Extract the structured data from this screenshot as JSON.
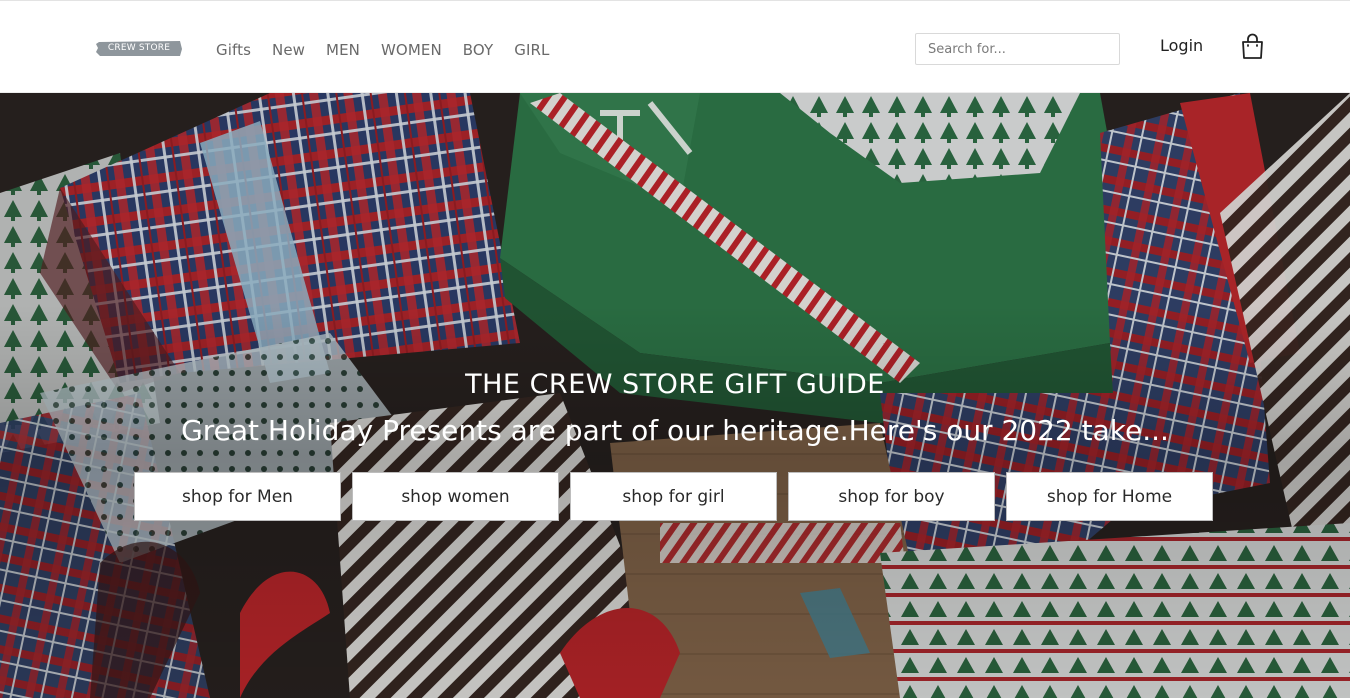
{
  "header": {
    "logo_text": "CREW STORE",
    "nav": [
      {
        "label": "Gifts"
      },
      {
        "label": "New"
      },
      {
        "label": "MEN"
      },
      {
        "label": "WOMEN"
      },
      {
        "label": "BOY"
      },
      {
        "label": "GIRL"
      }
    ],
    "search_placeholder": "Search for...",
    "search_value": "",
    "login_label": "Login",
    "cart_icon": "shopping-bag-icon"
  },
  "hero": {
    "title": "THE CREW STORE GIFT GUIDE",
    "subtitle": "Great Holiday Presents are part of our heritage.Here's our 2022 take...",
    "buttons": [
      {
        "label": "shop for Men"
      },
      {
        "label": "shop women"
      },
      {
        "label": "shop for girl"
      },
      {
        "label": "shop for boy"
      },
      {
        "label": "shop for Home"
      }
    ]
  },
  "colors": {
    "nav_text": "#6a6a6a",
    "logo_bg": "#8e969c",
    "plaid_red": "#b3262c",
    "box_green": "#2f7a4a",
    "knit_white": "#e9ecec"
  }
}
